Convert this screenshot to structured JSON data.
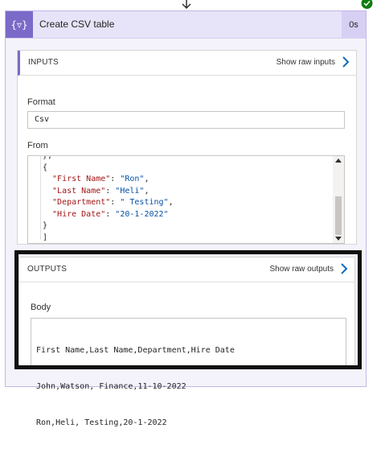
{
  "action": {
    "icon": "curly-braces-filter-icon",
    "title": "Create CSV table",
    "duration": "0s",
    "status": "succeeded"
  },
  "inputs": {
    "section_title": "INPUTS",
    "raw_link": "Show raw inputs",
    "format_label": "Format",
    "format_value": "Csv",
    "from_label": "From",
    "from_lines": [
      [
        {
          "t": "p",
          "v": "},"
        }
      ],
      [
        {
          "t": "p",
          "v": "{"
        }
      ],
      [
        {
          "t": "k",
          "v": "  \"First Name\""
        },
        {
          "t": "p",
          "v": ": "
        },
        {
          "t": "s",
          "v": "\"Ron\""
        },
        {
          "t": "p",
          "v": ","
        }
      ],
      [
        {
          "t": "k",
          "v": "  \"Last Name\""
        },
        {
          "t": "p",
          "v": ": "
        },
        {
          "t": "s",
          "v": "\"Heli\""
        },
        {
          "t": "p",
          "v": ","
        }
      ],
      [
        {
          "t": "k",
          "v": "  \"Department\""
        },
        {
          "t": "p",
          "v": ": "
        },
        {
          "t": "s",
          "v": "\" Testing\""
        },
        {
          "t": "p",
          "v": ","
        }
      ],
      [
        {
          "t": "k",
          "v": "  \"Hire Date\""
        },
        {
          "t": "p",
          "v": ": "
        },
        {
          "t": "s",
          "v": "\"20-1-2022\""
        }
      ],
      [
        {
          "t": "p",
          "v": "}"
        }
      ],
      [
        {
          "t": "p",
          "v": "]"
        }
      ]
    ]
  },
  "outputs": {
    "section_title": "OUTPUTS",
    "raw_link": "Show raw outputs",
    "body_label": "Body",
    "body_lines": [
      "First Name,Last Name,Department,Hire Date",
      "John,Watson, Finance,11-10-2022",
      "Ron,Heli, Testing,20-1-2022"
    ]
  },
  "colors": {
    "accent": "#7b6ac8",
    "header_bg": "#e7e3f8",
    "success": "#107c10",
    "json_key": "#a31515",
    "json_string": "#0451a5",
    "highlight_frame": "#111111"
  }
}
